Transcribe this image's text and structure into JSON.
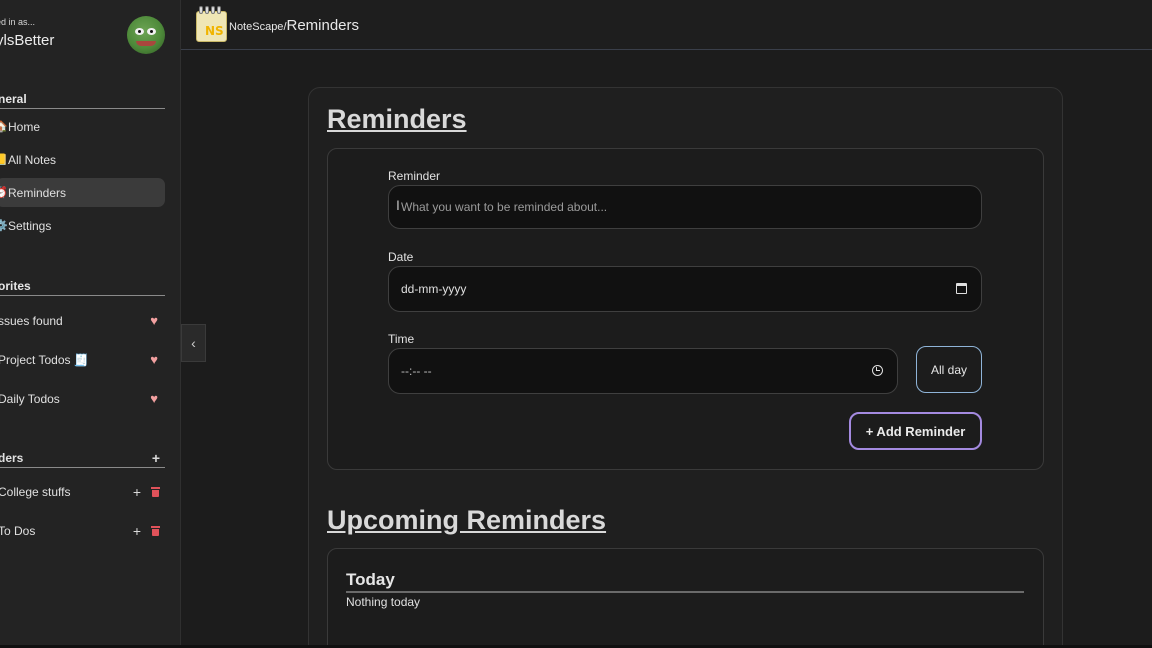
{
  "sidebar": {
    "user_caption": "ed in as...",
    "user_name": "ylsBetter",
    "general_title": "neral",
    "nav": [
      {
        "icon": "🏠",
        "label": "Home"
      },
      {
        "icon": "📒",
        "label": "All Notes"
      },
      {
        "icon": "⏰",
        "label": "Reminders"
      },
      {
        "icon": "⚙️",
        "label": "Settings"
      }
    ],
    "favorites_title": "orites",
    "favorites": [
      {
        "label": "ssues found"
      },
      {
        "label": "Project Todos 🧾"
      },
      {
        "label": "Daily Todos"
      }
    ],
    "folders_title": "ders",
    "folders_add": "+",
    "folders": [
      {
        "label": "College stuffs",
        "add": "+"
      },
      {
        "label": "To Dos",
        "add": "+"
      }
    ],
    "heart_glyph": "♥",
    "collapse_glyph": "‹"
  },
  "header": {
    "logo_text": "NS",
    "crumb_app": "NoteScape",
    "crumb_sep": "/",
    "crumb_page": "Reminders"
  },
  "main": {
    "title": "Reminders",
    "form": {
      "reminder_label": "Reminder",
      "reminder_placeholder": "What you want to be reminded about...",
      "date_label": "Date",
      "date_value": "dd-mm-yyyy",
      "time_label": "Time",
      "time_value": "--:-- --",
      "allday_label": "All day",
      "add_label": "+ Add Reminder"
    },
    "upcoming_title": "Upcoming Reminders",
    "today_title": "Today",
    "today_empty": "Nothing today"
  },
  "colors": {
    "accent_purple": "#a48ae0",
    "accent_blue": "#8fb4d8",
    "heart": "#f2a0a0",
    "trash": "#e0525a"
  }
}
